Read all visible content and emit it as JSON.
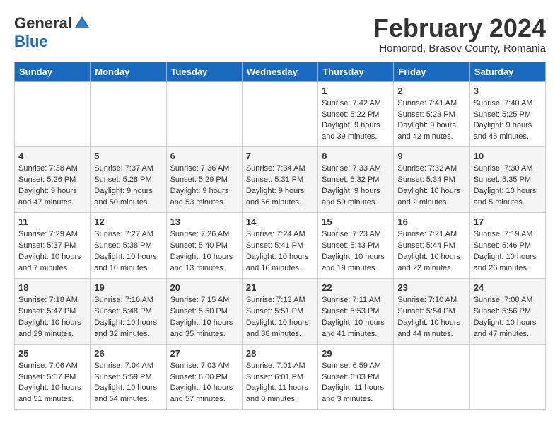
{
  "header": {
    "logo_general": "General",
    "logo_blue": "Blue",
    "month_year": "February 2024",
    "location": "Homorod, Brasov County, Romania"
  },
  "days_of_week": [
    "Sunday",
    "Monday",
    "Tuesday",
    "Wednesday",
    "Thursday",
    "Friday",
    "Saturday"
  ],
  "weeks": [
    [
      {
        "day": "",
        "content": ""
      },
      {
        "day": "",
        "content": ""
      },
      {
        "day": "",
        "content": ""
      },
      {
        "day": "",
        "content": ""
      },
      {
        "day": "1",
        "content": "Sunrise: 7:42 AM\nSunset: 5:22 PM\nDaylight: 9 hours\nand 39 minutes."
      },
      {
        "day": "2",
        "content": "Sunrise: 7:41 AM\nSunset: 5:23 PM\nDaylight: 9 hours\nand 42 minutes."
      },
      {
        "day": "3",
        "content": "Sunrise: 7:40 AM\nSunset: 5:25 PM\nDaylight: 9 hours\nand 45 minutes."
      }
    ],
    [
      {
        "day": "4",
        "content": "Sunrise: 7:38 AM\nSunset: 5:26 PM\nDaylight: 9 hours\nand 47 minutes."
      },
      {
        "day": "5",
        "content": "Sunrise: 7:37 AM\nSunset: 5:28 PM\nDaylight: 9 hours\nand 50 minutes."
      },
      {
        "day": "6",
        "content": "Sunrise: 7:36 AM\nSunset: 5:29 PM\nDaylight: 9 hours\nand 53 minutes."
      },
      {
        "day": "7",
        "content": "Sunrise: 7:34 AM\nSunset: 5:31 PM\nDaylight: 9 hours\nand 56 minutes."
      },
      {
        "day": "8",
        "content": "Sunrise: 7:33 AM\nSunset: 5:32 PM\nDaylight: 9 hours\nand 59 minutes."
      },
      {
        "day": "9",
        "content": "Sunrise: 7:32 AM\nSunset: 5:34 PM\nDaylight: 10 hours\nand 2 minutes."
      },
      {
        "day": "10",
        "content": "Sunrise: 7:30 AM\nSunset: 5:35 PM\nDaylight: 10 hours\nand 5 minutes."
      }
    ],
    [
      {
        "day": "11",
        "content": "Sunrise: 7:29 AM\nSunset: 5:37 PM\nDaylight: 10 hours\nand 7 minutes."
      },
      {
        "day": "12",
        "content": "Sunrise: 7:27 AM\nSunset: 5:38 PM\nDaylight: 10 hours\nand 10 minutes."
      },
      {
        "day": "13",
        "content": "Sunrise: 7:26 AM\nSunset: 5:40 PM\nDaylight: 10 hours\nand 13 minutes."
      },
      {
        "day": "14",
        "content": "Sunrise: 7:24 AM\nSunset: 5:41 PM\nDaylight: 10 hours\nand 16 minutes."
      },
      {
        "day": "15",
        "content": "Sunrise: 7:23 AM\nSunset: 5:43 PM\nDaylight: 10 hours\nand 19 minutes."
      },
      {
        "day": "16",
        "content": "Sunrise: 7:21 AM\nSunset: 5:44 PM\nDaylight: 10 hours\nand 22 minutes."
      },
      {
        "day": "17",
        "content": "Sunrise: 7:19 AM\nSunset: 5:46 PM\nDaylight: 10 hours\nand 26 minutes."
      }
    ],
    [
      {
        "day": "18",
        "content": "Sunrise: 7:18 AM\nSunset: 5:47 PM\nDaylight: 10 hours\nand 29 minutes."
      },
      {
        "day": "19",
        "content": "Sunrise: 7:16 AM\nSunset: 5:48 PM\nDaylight: 10 hours\nand 32 minutes."
      },
      {
        "day": "20",
        "content": "Sunrise: 7:15 AM\nSunset: 5:50 PM\nDaylight: 10 hours\nand 35 minutes."
      },
      {
        "day": "21",
        "content": "Sunrise: 7:13 AM\nSunset: 5:51 PM\nDaylight: 10 hours\nand 38 minutes."
      },
      {
        "day": "22",
        "content": "Sunrise: 7:11 AM\nSunset: 5:53 PM\nDaylight: 10 hours\nand 41 minutes."
      },
      {
        "day": "23",
        "content": "Sunrise: 7:10 AM\nSunset: 5:54 PM\nDaylight: 10 hours\nand 44 minutes."
      },
      {
        "day": "24",
        "content": "Sunrise: 7:08 AM\nSunset: 5:56 PM\nDaylight: 10 hours\nand 47 minutes."
      }
    ],
    [
      {
        "day": "25",
        "content": "Sunrise: 7:06 AM\nSunset: 5:57 PM\nDaylight: 10 hours\nand 51 minutes."
      },
      {
        "day": "26",
        "content": "Sunrise: 7:04 AM\nSunset: 5:59 PM\nDaylight: 10 hours\nand 54 minutes."
      },
      {
        "day": "27",
        "content": "Sunrise: 7:03 AM\nSunset: 6:00 PM\nDaylight: 10 hours\nand 57 minutes."
      },
      {
        "day": "28",
        "content": "Sunrise: 7:01 AM\nSunset: 6:01 PM\nDaylight: 11 hours\nand 0 minutes."
      },
      {
        "day": "29",
        "content": "Sunrise: 6:59 AM\nSunset: 6:03 PM\nDaylight: 11 hours\nand 3 minutes."
      },
      {
        "day": "",
        "content": ""
      },
      {
        "day": "",
        "content": ""
      }
    ]
  ]
}
